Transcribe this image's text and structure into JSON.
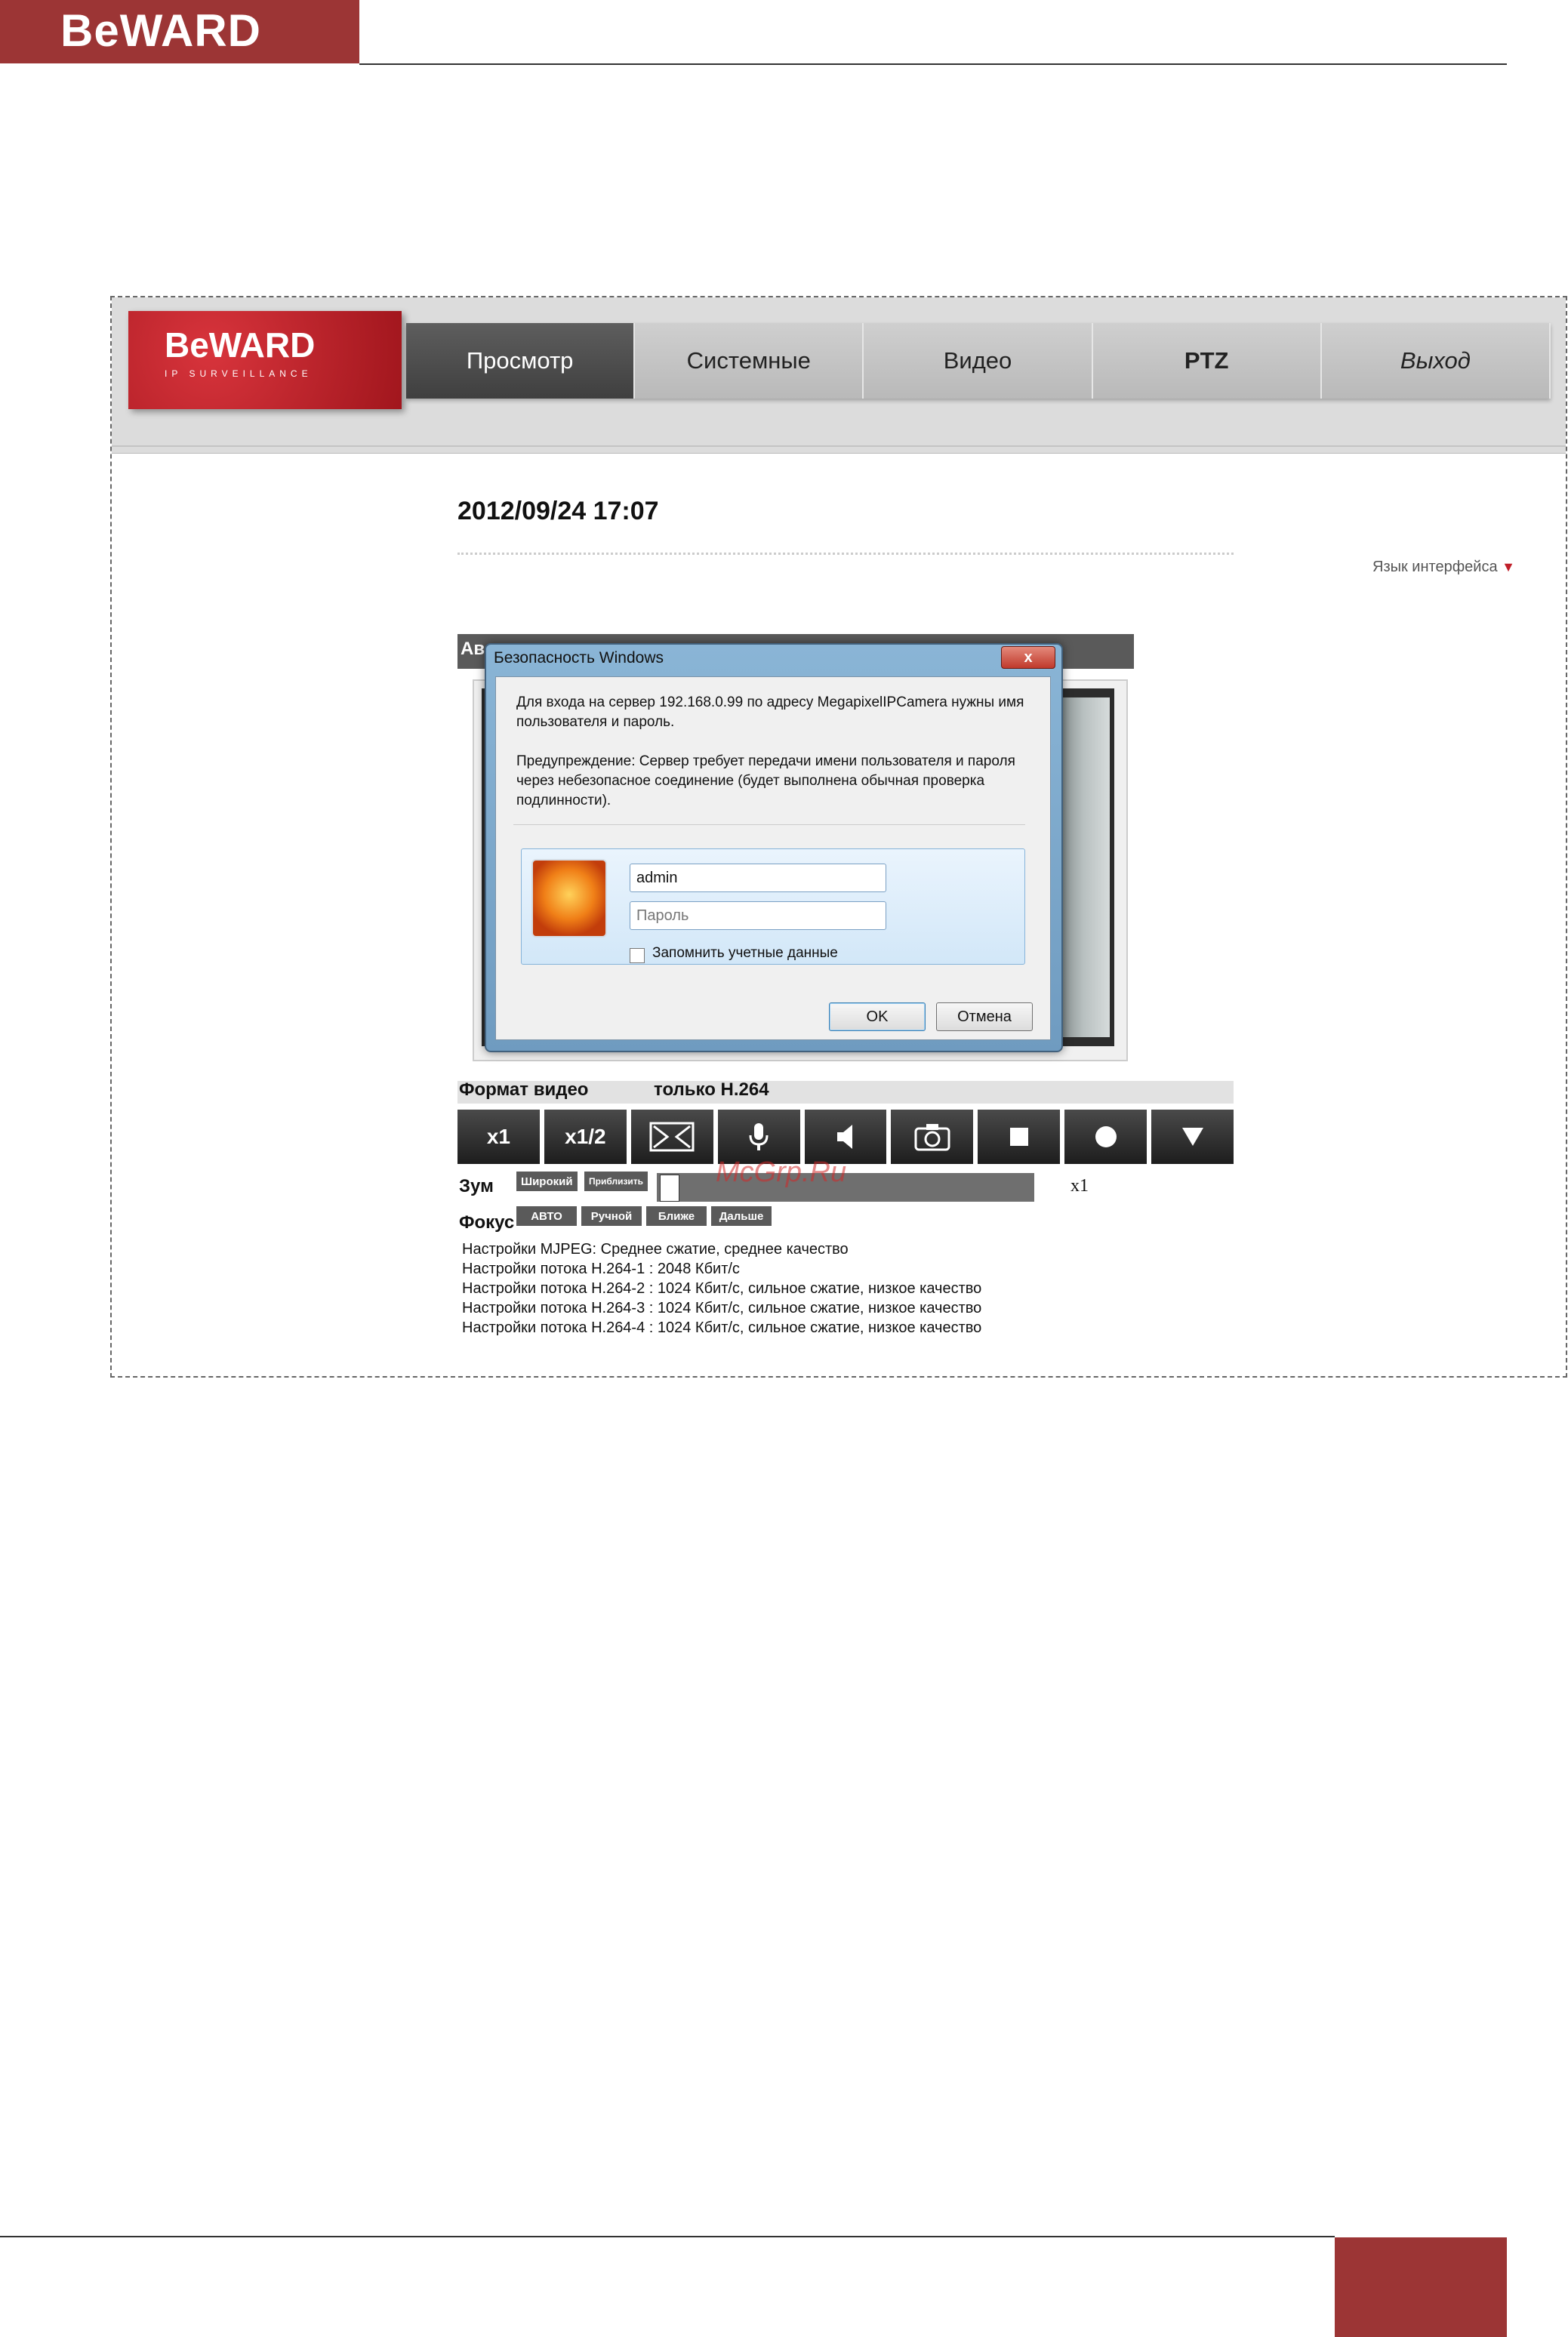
{
  "page_header": {
    "logo_text": "BeWARD"
  },
  "screenshot": {
    "brand": {
      "name": "BeWARD",
      "tagline": "IP SURVEILLANCE"
    },
    "nav": [
      {
        "label": "Просмотр",
        "active": true
      },
      {
        "label": "Системные"
      },
      {
        "label": "Видео"
      },
      {
        "label": "PTZ"
      },
      {
        "label": "Выход"
      }
    ],
    "datetime": "2012/09/24 17:07",
    "language_link": "Язык интерфейса",
    "video_title_partial": "Ав",
    "dialog": {
      "title": "Безопасность Windows",
      "close_symbol": "x",
      "message": "Для входа на сервер 192.168.0.99  по адресу MegapixelIPCamera нужны имя пользователя и пароль.",
      "warning": "Предупреждение: Сервер требует передачи имени пользователя и пароля через небезопасное соединение (будет выполнена обычная проверка подлинности).",
      "username_value": "admin",
      "password_placeholder": "Пароль",
      "remember_label": "Запомнить учетные данные",
      "remember_checked": false,
      "ok_label": "OK",
      "cancel_label": "Отмена"
    },
    "video_format": {
      "label": "Формат видео",
      "value": "только H.264"
    },
    "controls": [
      "x1",
      "x1/2",
      "fullscreen-icon",
      "microphone-icon",
      "speaker-icon",
      "camera-icon",
      "stop-icon",
      "record-icon",
      "dropdown-icon"
    ],
    "control_labels": {
      "x1": "x1",
      "x1_2": "x1/2"
    },
    "zoom": {
      "label": "Зум",
      "wide_label": "Широкий",
      "tele_label": "Приблизить",
      "value": "x1",
      "level": 0
    },
    "focus": {
      "label": "Фокус",
      "buttons": [
        "АВТО",
        "Ручной",
        "Ближе",
        "Дальше"
      ]
    },
    "watermark": "McGrp.Ru",
    "stream_settings": [
      "Настройки MJPEG: Среднее сжатие, среднее качество",
      "Настройки потока H.264-1 : 2048 Кбит/с",
      "Настройки потока H.264-2 : 1024 Кбит/с, сильное сжатие, низкое качество",
      "Настройки потока H.264-3 : 1024 Кбит/с, сильное сжатие, низкое качество",
      "Настройки потока H.264-4 : 1024 Кбит/с, сильное сжатие, низкое качество"
    ]
  },
  "colors": {
    "brand_red": "#9c3535",
    "nav_active": "#4a4a4a",
    "accent_red": "#c0202a"
  }
}
